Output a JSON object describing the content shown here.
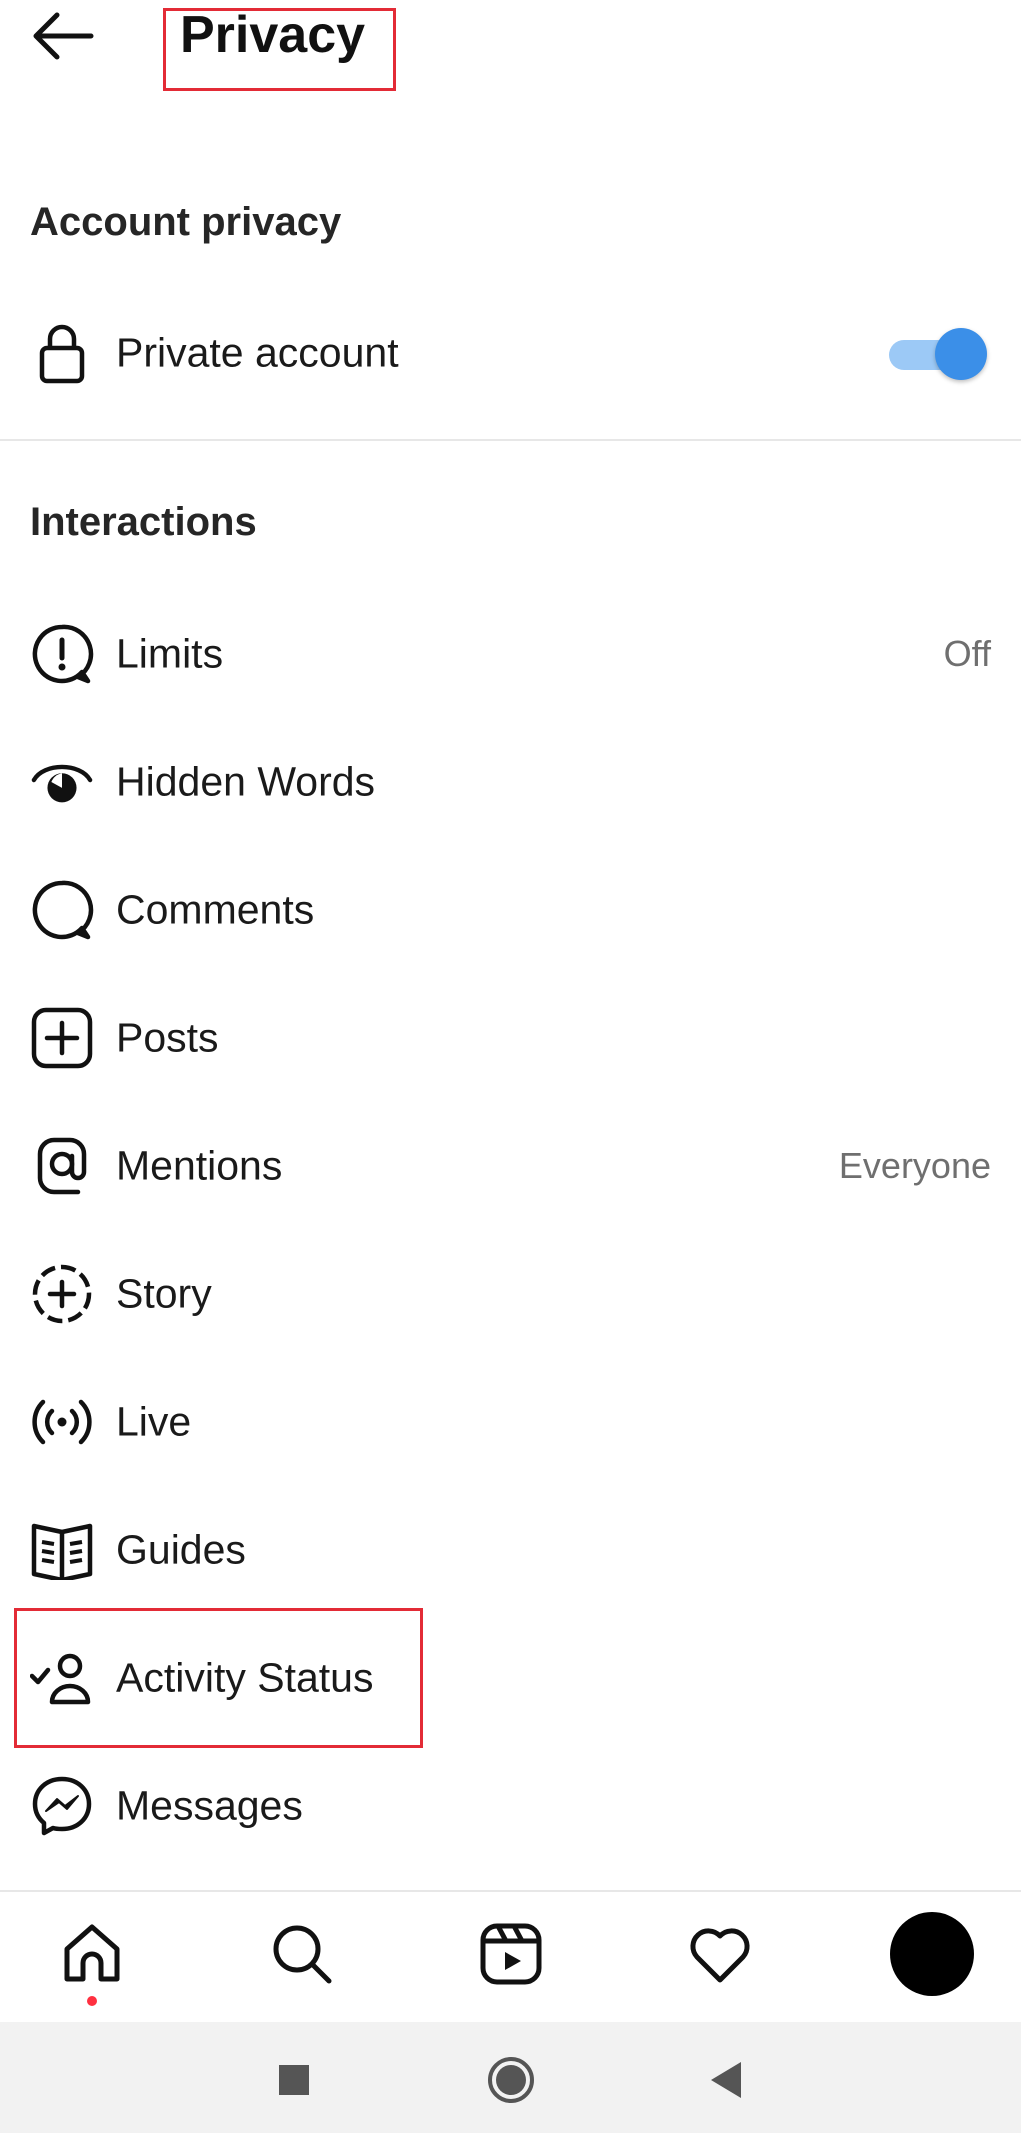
{
  "header": {
    "title": "Privacy",
    "back_icon": "arrow-left-icon"
  },
  "sections": {
    "account_privacy": {
      "heading": "Account privacy",
      "private_account": {
        "label": "Private account",
        "icon": "lock-icon",
        "toggle_on": true
      }
    },
    "interactions": {
      "heading": "Interactions",
      "items": [
        {
          "label": "Limits",
          "value": "Off",
          "icon": "limits-alert-icon"
        },
        {
          "label": "Hidden Words",
          "value": "",
          "icon": "hidden-eye-icon"
        },
        {
          "label": "Comments",
          "value": "",
          "icon": "comment-icon"
        },
        {
          "label": "Posts",
          "value": "",
          "icon": "plus-square-icon"
        },
        {
          "label": "Mentions",
          "value": "Everyone",
          "icon": "at-sign-icon"
        },
        {
          "label": "Story",
          "value": "",
          "icon": "story-add-icon"
        },
        {
          "label": "Live",
          "value": "",
          "icon": "live-broadcast-icon"
        },
        {
          "label": "Guides",
          "value": "",
          "icon": "guides-book-icon"
        },
        {
          "label": "Activity Status",
          "value": "",
          "icon": "activity-status-icon"
        },
        {
          "label": "Messages",
          "value": "",
          "icon": "messenger-icon"
        }
      ]
    }
  },
  "bottom_nav": {
    "items": [
      "home-icon",
      "search-icon",
      "reels-icon",
      "heart-icon",
      "profile-avatar"
    ]
  },
  "system_nav": [
    "recents-square-icon",
    "home-circle-icon",
    "back-triangle-icon"
  ],
  "colors": {
    "accent": "#3b8fe8",
    "toggle_track": "#9cc9f6",
    "highlight_box": "#e32b36",
    "notification_dot": "#ff3040"
  }
}
